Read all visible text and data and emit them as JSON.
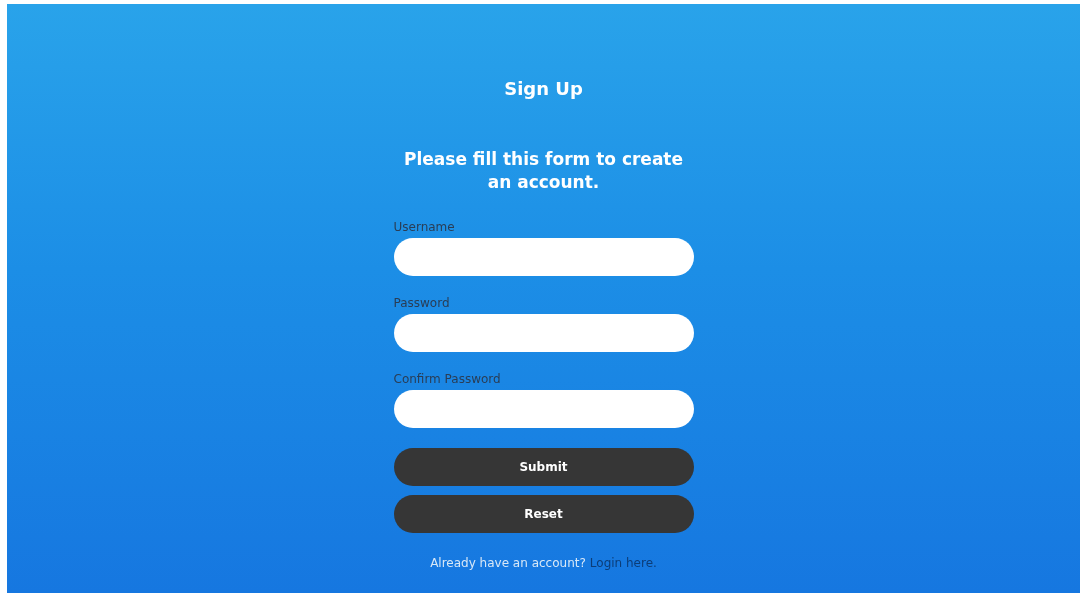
{
  "title": "Sign Up",
  "subtitle": "Please fill this form to create an account.",
  "fields": [
    {
      "label": "Username"
    },
    {
      "label": "Password"
    },
    {
      "label": "Confirm Password"
    }
  ],
  "buttons": [
    {
      "label": "Submit"
    },
    {
      "label": "Reset"
    }
  ],
  "footer": {
    "text": "Already have an account?",
    "link": "Login here."
  }
}
